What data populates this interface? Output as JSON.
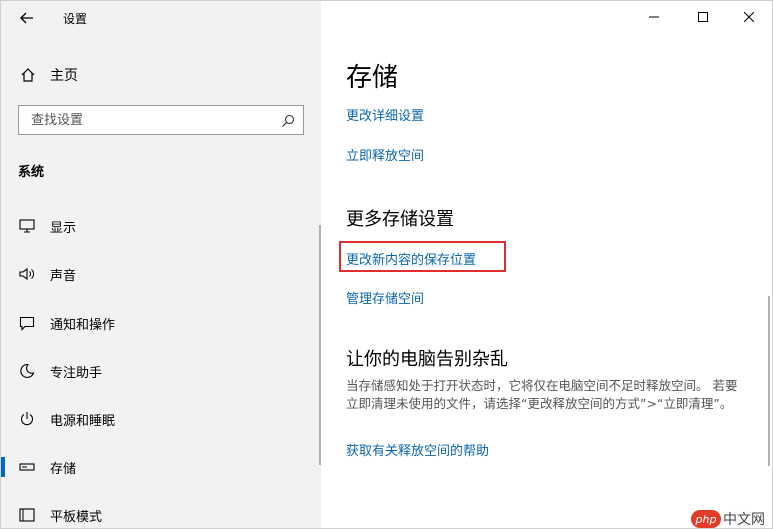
{
  "titlebar": {
    "title": "设置"
  },
  "sidebar": {
    "home_label": "主页",
    "search_placeholder": "查找设置",
    "section": "系统",
    "items": [
      {
        "label": "显示",
        "icon": "display-icon"
      },
      {
        "label": "声音",
        "icon": "speaker-icon"
      },
      {
        "label": "通知和操作",
        "icon": "notification-icon"
      },
      {
        "label": "专注助手",
        "icon": "moon-icon"
      },
      {
        "label": "电源和睡眠",
        "icon": "power-icon"
      },
      {
        "label": "存储",
        "icon": "storage-icon",
        "selected": true
      },
      {
        "label": "平板模式",
        "icon": "tablet-icon"
      }
    ]
  },
  "main": {
    "title": "存储",
    "links_top": [
      "更改详细设置",
      "立即释放空间"
    ],
    "more_heading": "更多存储设置",
    "more_links": [
      "更改新内容的保存位置",
      "管理存储空间"
    ],
    "tidy_heading": "让你的电脑告别杂乱",
    "tidy_desc": "当存储感知处于打开状态时，它将仅在电脑空间不足时释放空间。 若要立即清理未使用的文件，请选择“更改释放空间的方式”>“立即清理”。",
    "help_link": "获取有关释放空间的帮助"
  },
  "colors": {
    "accent": "#0067c0",
    "link": "#0b66ae",
    "highlight": "#e02d2d"
  },
  "watermark": {
    "badge": "php",
    "text": "中文网"
  }
}
